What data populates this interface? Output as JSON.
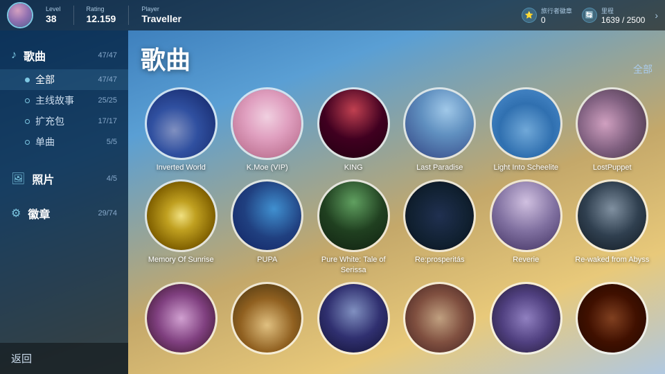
{
  "bg": {},
  "topbar": {
    "level_label": "Level",
    "level_value": "38",
    "rating_label": "Rating",
    "rating_value": "12.159",
    "player_label": "Player",
    "player_value": "Traveller",
    "badge1_label": "旅行者徽章",
    "badge1_value": "0",
    "badge2_label": "里程",
    "badge2_value": "1639 / 2500",
    "arrow": "›"
  },
  "sidebar": {
    "songs_icon": "♪",
    "songs_label": "歌曲",
    "songs_count": "47/47",
    "sub_items": [
      {
        "label": "全部",
        "count": "47/47",
        "active": true
      },
      {
        "label": "主线故事",
        "count": "25/25",
        "active": false
      },
      {
        "label": "扩充包",
        "count": "17/17",
        "active": false
      },
      {
        "label": "单曲",
        "count": "5/5",
        "active": false
      }
    ],
    "photos_icon": "🖼",
    "photos_label": "照片",
    "photos_count": "4/5",
    "badges_icon": "⚙",
    "badges_label": "徽章",
    "badges_count": "29/74",
    "back_label": "返回"
  },
  "main": {
    "title": "歌曲",
    "filter_label": "全部",
    "songs": [
      {
        "name": "Inverted World",
        "art": "art-inverted"
      },
      {
        "name": "K.Moe (VIP)",
        "art": "art-kmoe"
      },
      {
        "name": "KING",
        "art": "art-king"
      },
      {
        "name": "Last Paradise",
        "art": "art-lastparadise"
      },
      {
        "name": "Light Into Scheelite",
        "art": "art-lightinto"
      },
      {
        "name": "LostPuppet",
        "art": "art-lostpuppet"
      },
      {
        "name": "Memory Of Sunrise",
        "art": "art-memory"
      },
      {
        "name": "PUPA",
        "art": "art-pupa"
      },
      {
        "name": "Pure White: Tale of Serissa",
        "art": "art-purewhite"
      },
      {
        "name": "Re:prosperitás",
        "art": "art-reprosperitas"
      },
      {
        "name": "Reverie",
        "art": "art-reverie"
      },
      {
        "name": "Re-waked from Abyss",
        "art": "art-rewaked"
      },
      {
        "name": "",
        "art": "art-row3a"
      },
      {
        "name": "",
        "art": "art-row3b"
      },
      {
        "name": "",
        "art": "art-row3c"
      },
      {
        "name": "",
        "art": "art-row3d"
      },
      {
        "name": "",
        "art": "art-row3e"
      },
      {
        "name": "",
        "art": "art-row3f"
      }
    ]
  }
}
